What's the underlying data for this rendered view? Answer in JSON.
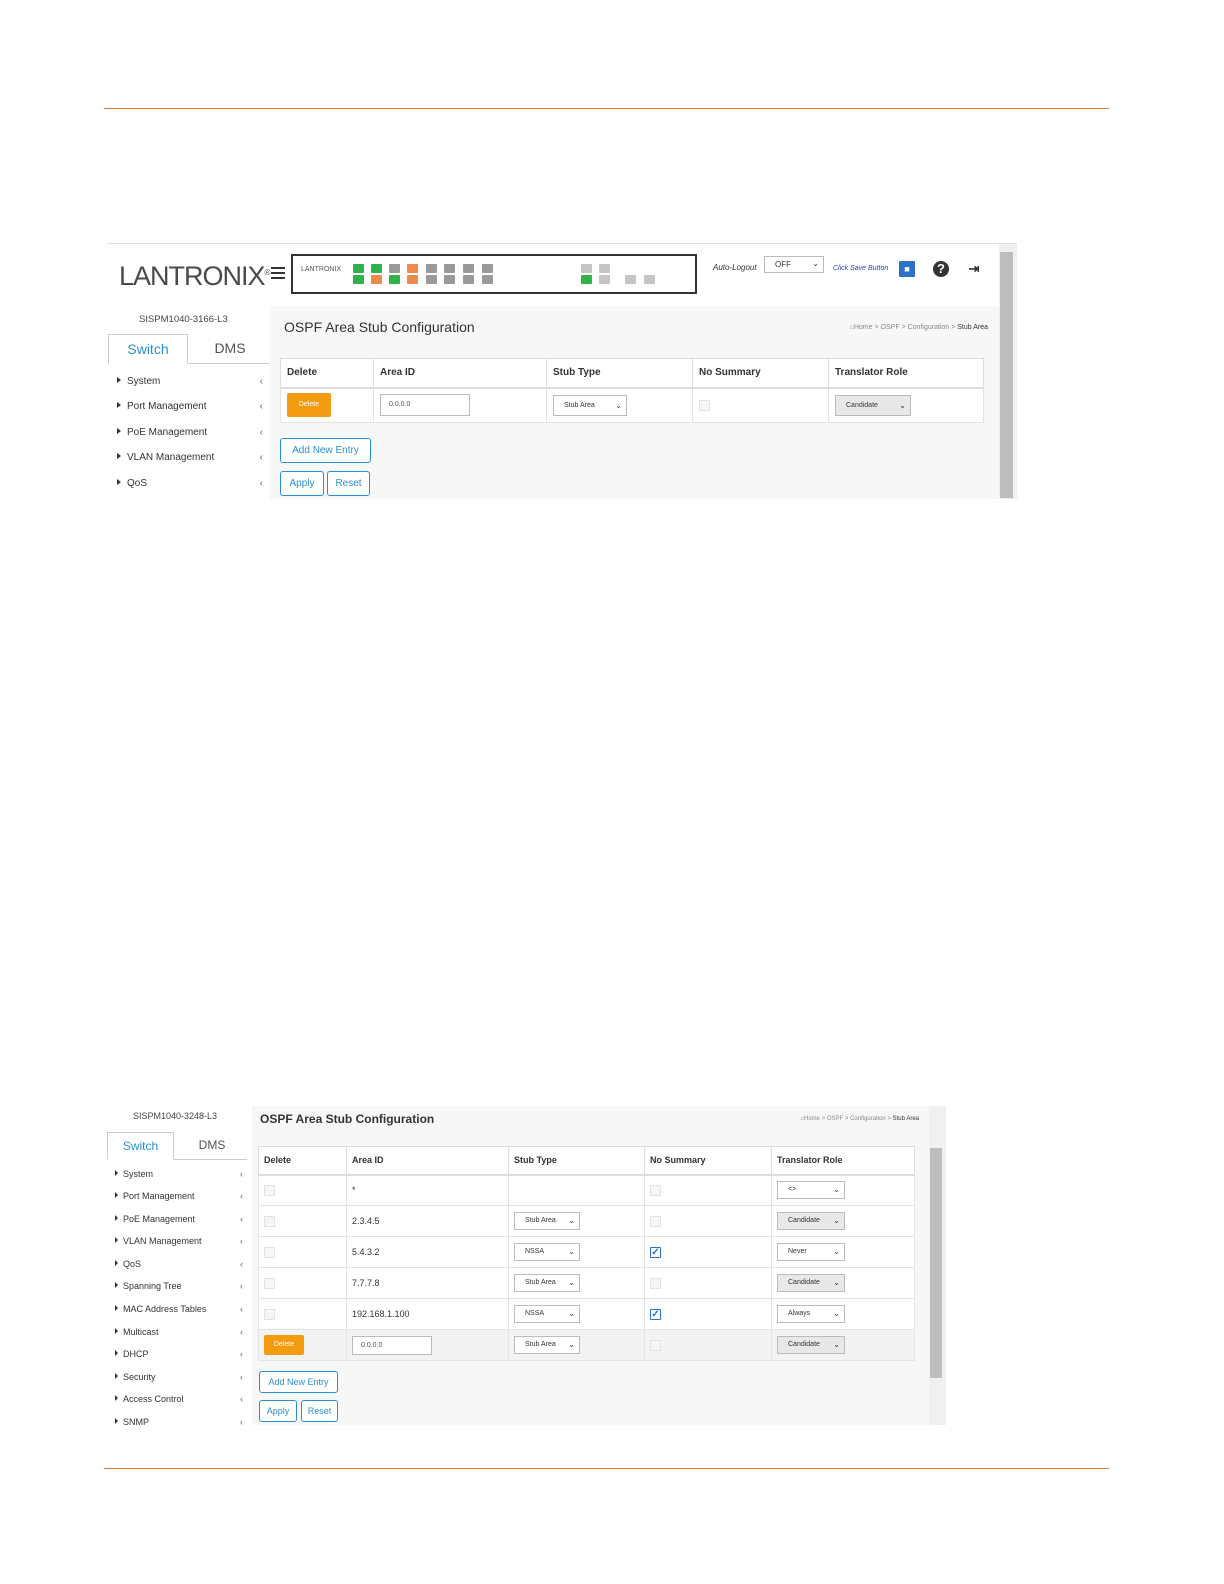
{
  "shot1": {
    "logo": "LANTRONIX",
    "panel_logo": "LANTRONIX",
    "auto_logout_label": "Auto-Logout",
    "auto_logout_value": "OFF",
    "save_hint": "Click Save Button",
    "device_name": "SISPM1040-3166-L3",
    "tabs": {
      "switch": "Switch",
      "dms": "DMS"
    },
    "nav": [
      "System",
      "Port Management",
      "PoE Management",
      "VLAN Management",
      "QoS"
    ],
    "page_title": "OSPF Area Stub Configuration",
    "breadcrumb": {
      "home": "Home",
      "b1": "OSPF",
      "b2": "Configuration",
      "b3": "Stub Area",
      "sep": ">"
    },
    "columns": [
      "Delete",
      "Area ID",
      "Stub Type",
      "No Summary",
      "Translator Role"
    ],
    "row": {
      "delete": "Delete",
      "area_id": "0.0.0.0",
      "stub_type": "Stub Area",
      "no_summary": false,
      "translator_role": "Candidate"
    },
    "buttons": {
      "add": "Add New Entry",
      "apply": "Apply",
      "reset": "Reset"
    }
  },
  "shot2": {
    "device_name": "SISPM1040-3248-L3",
    "tabs": {
      "switch": "Switch",
      "dms": "DMS"
    },
    "nav": [
      "System",
      "Port Management",
      "PoE Management",
      "VLAN Management",
      "QoS",
      "Spanning Tree",
      "MAC Address Tables",
      "Multicast",
      "DHCP",
      "Security",
      "Access Control",
      "SNMP"
    ],
    "page_title": "OSPF Area Stub Configuration",
    "breadcrumb": {
      "home": "Home",
      "b1": "OSPF",
      "b2": "Configuration",
      "b3": "Stub Area",
      "sep": ">"
    },
    "columns": [
      "Delete",
      "Area ID",
      "Stub Type",
      "No Summary",
      "Translator Role"
    ],
    "rows": [
      {
        "area_id": "*",
        "stub_type": "",
        "no_summary": false,
        "translator_role": "<>"
      },
      {
        "area_id": "2.3.4.5",
        "stub_type": "Stub Area",
        "no_summary": false,
        "translator_role": "Candidate"
      },
      {
        "area_id": "5.4.3.2",
        "stub_type": "NSSA",
        "no_summary": true,
        "translator_role": "Never"
      },
      {
        "area_id": "7.7.7.8",
        "stub_type": "Stub Area",
        "no_summary": false,
        "translator_role": "Candidate"
      },
      {
        "area_id": "192.168.1.100",
        "stub_type": "NSSA",
        "no_summary": true,
        "translator_role": "Always"
      }
    ],
    "new_row": {
      "delete": "Delete",
      "area_id": "0.0.0.0",
      "stub_type": "Stub Area",
      "no_summary": false,
      "translator_role": "Candidate"
    },
    "buttons": {
      "add": "Add New Entry",
      "apply": "Apply",
      "reset": "Reset"
    }
  },
  "colors": {
    "accent_line": "#e07b39",
    "link_blue": "#2a8fd0",
    "delete_orange": "#f39c12"
  }
}
